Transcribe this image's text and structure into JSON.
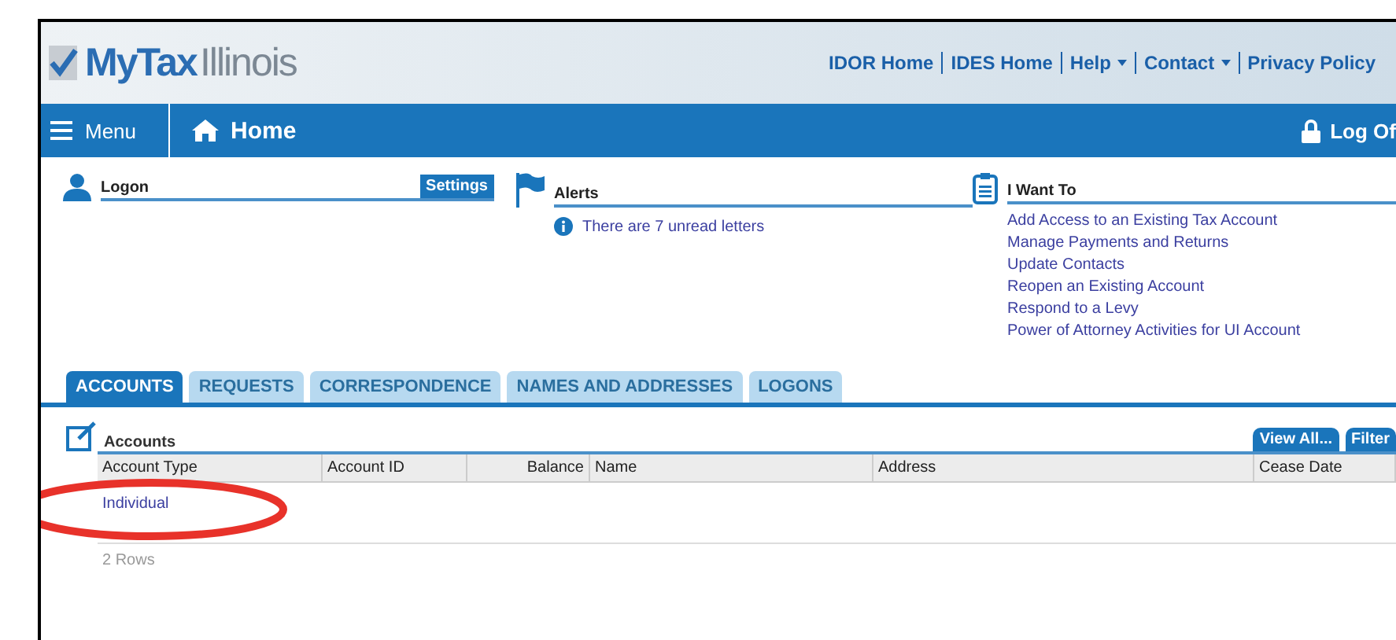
{
  "header": {
    "logo": {
      "primary": "MyTax",
      "secondary": "Illinois"
    },
    "links": [
      {
        "label": "IDOR Home",
        "dropdown": false
      },
      {
        "label": "IDES Home",
        "dropdown": false
      },
      {
        "label": "Help",
        "dropdown": true
      },
      {
        "label": "Contact",
        "dropdown": true
      },
      {
        "label": "Privacy Policy",
        "dropdown": false
      }
    ]
  },
  "nav": {
    "menu": "Menu",
    "home": "Home",
    "logoff": "Log Of"
  },
  "panels": {
    "logon": {
      "title": "Logon",
      "button": "Settings"
    },
    "alerts": {
      "title": "Alerts",
      "items": [
        "There are 7 unread letters"
      ]
    },
    "i_want_to": {
      "title": "I Want To",
      "links": [
        "Add Access to an Existing Tax Account",
        "Manage Payments and Returns",
        "Update Contacts",
        "Reopen an Existing Account",
        "Respond to a Levy",
        "Power of Attorney Activities for UI Account"
      ]
    }
  },
  "tabs": [
    {
      "label": "ACCOUNTS",
      "selected": true
    },
    {
      "label": "REQUESTS",
      "selected": false
    },
    {
      "label": "CORRESPONDENCE",
      "selected": false
    },
    {
      "label": "NAMES AND ADDRESSES",
      "selected": false
    },
    {
      "label": "LOGONS",
      "selected": false
    }
  ],
  "accounts": {
    "title": "Accounts",
    "buttons": [
      "View All...",
      "Filter"
    ],
    "columns": [
      {
        "label": "Account Type",
        "kind": "text"
      },
      {
        "label": "Account ID",
        "kind": "text"
      },
      {
        "label": "Balance",
        "kind": "amount"
      },
      {
        "label": "Name",
        "kind": "text"
      },
      {
        "label": "Address",
        "kind": "text"
      },
      {
        "label": "Cease Date",
        "kind": "text"
      }
    ],
    "group": "Individual",
    "row_count": "2 Rows"
  }
}
